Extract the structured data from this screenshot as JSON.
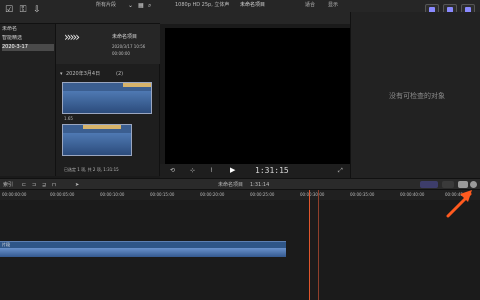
{
  "toolbar": {
    "left_icons": [
      "checkbox-icon",
      "key-icon",
      "import-icon"
    ],
    "browser_filter": "所有片段",
    "viewer_format": "1080p HD 25p, 立体声",
    "viewer_title": "未命名项目",
    "viewer_zoom": "适合",
    "viewer_display": "显示",
    "right_buttons": [
      "panel-toggle-1",
      "panel-toggle-2",
      "panel-toggle-3"
    ]
  },
  "library": {
    "items": [
      {
        "label": "未命名"
      },
      {
        "label": "智能精选"
      },
      {
        "label": "2020-3-17"
      }
    ]
  },
  "browser": {
    "project_title": "未命名项目",
    "project_date": "2020/3/17 10:56",
    "project_duration": "00:00:00",
    "date_group": "2020年3月4日",
    "date_group_count": "(2)",
    "clip1_label": "1.65",
    "footer_text": "已选定 1 项, 共 2 项, 1:31:15"
  },
  "viewer_controls": {
    "timecode": "1:31:15",
    "play_icon": "▶"
  },
  "inspector": {
    "empty_message": "没有可检查的对象"
  },
  "timeline": {
    "index_label": "索引",
    "title": "未命名项目",
    "duration": "1:31:14",
    "ruler_marks": [
      "00:00:00:00",
      "00:00:05:00",
      "00:00:10:00",
      "00:00:15:00",
      "00:00:20:00",
      "00:00:25:00",
      "00:00:30:00",
      "00:00:35:00",
      "00:00:40:00",
      "00:00:45:00"
    ],
    "clip_label": "片段"
  }
}
